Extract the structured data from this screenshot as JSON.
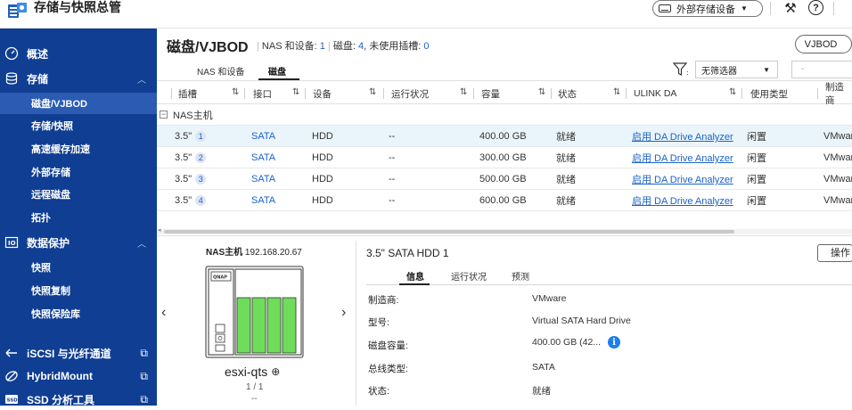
{
  "app": {
    "title": "存储与快照总管"
  },
  "topbar": {
    "external_storage_label": "外部存储设备"
  },
  "sidebar": {
    "overview": "概述",
    "storage": {
      "label": "存储",
      "items": [
        "磁盘/VJBOD",
        "存储/快照",
        "高速缓存加速",
        "外部存储",
        "远程磁盘",
        "拓扑"
      ]
    },
    "data_protection": {
      "label": "数据保护",
      "items": [
        "快照",
        "快照复制",
        "快照保险库"
      ]
    },
    "iscsi": "iSCSI 与光纤通道",
    "hybridmount": "HybridMount",
    "ssd_tool": "SSD 分析工具"
  },
  "main": {
    "title": "磁盘/VJBOD",
    "subtitle": {
      "nas_label": "NAS 和设备: ",
      "nas_count": "1",
      "disk_label": "磁盘: ",
      "disk_count": "4",
      "slots_label": ", 未使用插槽: ",
      "slots_count": "0"
    },
    "vjbod_button": "VJBOD",
    "tabs": [
      "NAS 和设备",
      "磁盘"
    ],
    "filter": {
      "selected": "无筛选器"
    },
    "search": {
      "placeholder": "-"
    }
  },
  "table": {
    "columns": [
      "插槽",
      "接口",
      "设备",
      "运行状况",
      "容量",
      "状态",
      "ULINK DA",
      "使用类型",
      "制造商"
    ],
    "group": "NAS主机",
    "rows": [
      {
        "slot": "3.5\"",
        "slot_num": "1",
        "interface": "SATA",
        "device": "HDD",
        "health": "--",
        "capacity": "400.00 GB",
        "status": "就绪",
        "ulink": "启用 DA Drive Analyzer",
        "usage": "闲置",
        "vendor": "VMware"
      },
      {
        "slot": "3.5\"",
        "slot_num": "2",
        "interface": "SATA",
        "device": "HDD",
        "health": "--",
        "capacity": "300.00 GB",
        "status": "就绪",
        "ulink": "启用 DA Drive Analyzer",
        "usage": "闲置",
        "vendor": "VMware"
      },
      {
        "slot": "3.5\"",
        "slot_num": "3",
        "interface": "SATA",
        "device": "HDD",
        "health": "--",
        "capacity": "500.00 GB",
        "status": "就绪",
        "ulink": "启用 DA Drive Analyzer",
        "usage": "闲置",
        "vendor": "VMware"
      },
      {
        "slot": "3.5\"",
        "slot_num": "4",
        "interface": "SATA",
        "device": "HDD",
        "health": "--",
        "capacity": "600.00 GB",
        "status": "就绪",
        "ulink": "启用 DA Drive Analyzer",
        "usage": "闲置",
        "vendor": "VMware"
      }
    ]
  },
  "device": {
    "label": "NAS主机",
    "ip": "192.168.20.67",
    "brand": "QNAP",
    "name": "esxi-qts",
    "page": "1 / 1",
    "dash": "--"
  },
  "detail": {
    "title": "3.5\" SATA HDD 1",
    "ops_button": "操作",
    "tabs": [
      "信息",
      "运行状况",
      "预测"
    ],
    "fields": [
      {
        "label": "制造商:",
        "value": "VMware"
      },
      {
        "label": "型号:",
        "value": "Virtual SATA Hard Drive"
      },
      {
        "label": "磁盘容量:",
        "value": "400.00 GB (42..."
      },
      {
        "label": "总线类型:",
        "value": "SATA"
      },
      {
        "label": "状态:",
        "value": "就绪"
      }
    ]
  },
  "colors": {
    "sidebar": "#0f3e92",
    "sidebar_active": "#2b5bb2",
    "link": "#1a62c9",
    "drive_bay": "#6fdc5a",
    "selected_row": "#eaf5fb"
  }
}
